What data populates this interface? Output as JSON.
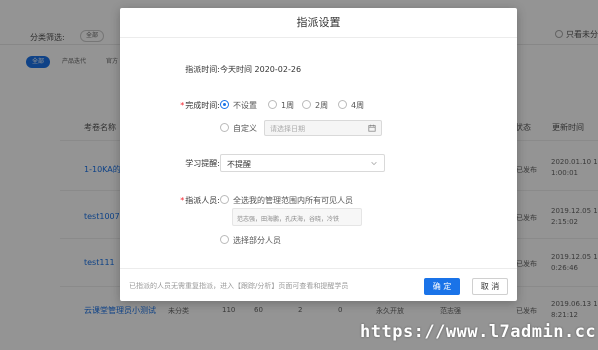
{
  "background": {
    "filter_label": "分类筛选:",
    "filter_chip": "全部",
    "only_label": "只看未分",
    "tabs": [
      "全部",
      "产品迭代",
      "官方"
    ],
    "columns": {
      "name": "考卷名称",
      "status": "状态",
      "updated": "更新时间"
    },
    "rows": [
      {
        "name": "1-10KA的",
        "status": "已发布",
        "updated": "2020.01.10 1\n1:00:01"
      },
      {
        "name": "test1007",
        "status": "已发布",
        "updated": "2019.12.05 1\n2:15:02"
      },
      {
        "name": "test111",
        "status": "已发布",
        "updated": "2019.12.05 1\n0:26:46"
      },
      {
        "name": "云课堂管理员小测试",
        "status": "已发布",
        "updated": "2019.06.13 1\n8:21:12",
        "extra": [
          "未分类",
          "110",
          "60",
          "2",
          "0",
          "永久开放",
          "范志强"
        ]
      }
    ]
  },
  "modal": {
    "title": "指派设置",
    "assign_time_label": "指派时间:",
    "assign_time_value": "今天时间 2020-02-26",
    "finish_time_label": "完成时间:",
    "finish_options": [
      "不设置",
      "1周",
      "2周",
      "4周"
    ],
    "custom_label": "自定义",
    "date_placeholder": "请选择日期",
    "reminder_label": "学习提醒:",
    "reminder_value": "不提醒",
    "people_label": "指派人员:",
    "people_option_all": "全选我的管理范围内所有可见人员",
    "people_names": "范志强，田海鹏，孔庆海，谷晓，冷铁",
    "people_option_partial": "选择部分人员",
    "footer_note": "已指派的人员无需重复指派，进入【跟踪/分析】页面可查看和提醒学员",
    "confirm_label": "确 定",
    "cancel_label": "取 消"
  },
  "watermark": "https://www.l7admin.cc",
  "colors": {
    "accent": "#1a73e8",
    "required": "#f5222d"
  }
}
